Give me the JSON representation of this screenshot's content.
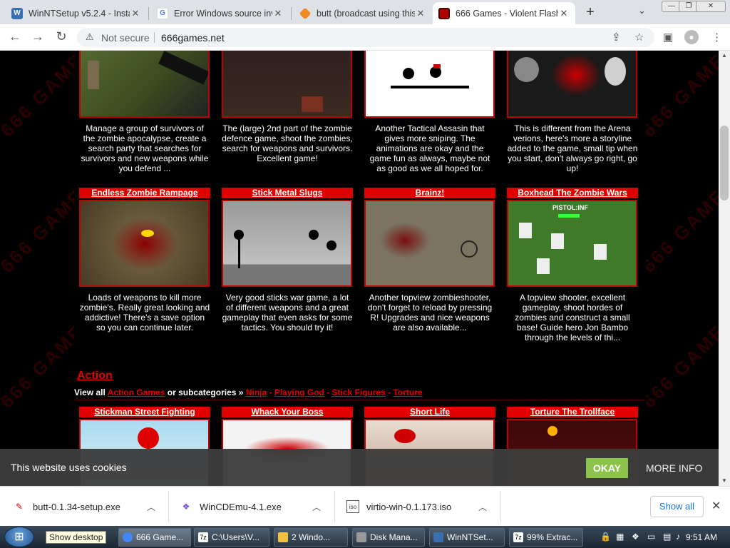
{
  "browser": {
    "tabs": [
      {
        "title": "WinNTSetup v5.2.4 - Insta",
        "icon": "winntsetup-favicon",
        "color": "#3a6fb0",
        "active": false
      },
      {
        "title": "Error Windows source inv",
        "icon": "google-favicon",
        "color": "#4285f4",
        "active": false
      },
      {
        "title": "butt (broadcast using this",
        "icon": "diamond-favicon",
        "color": "#f08a24",
        "active": false
      },
      {
        "title": "666 Games - Violent Flash",
        "icon": "666-favicon",
        "color": "#b00000",
        "active": true
      }
    ],
    "new_tab": "+",
    "not_secure": "Not secure",
    "url": "666games.net"
  },
  "games_row1": [
    {
      "desc": "Manage a group of survivors of the zombie apocalypse, create a search party that searches for survivors and new weapons while you defend ..."
    },
    {
      "desc": "The (large) 2nd part of the zombie defence game, shoot the zombies, search for weapons and survivors. Excellent game!"
    },
    {
      "desc": "Another Tactical Assasin that gives more sniping. The animations are okay and the game fun as always, maybe not as good as we all hoped for."
    },
    {
      "desc": "This is different from the Arena verions, here's more a storyline added to the game, small tip when you start, don't always go right, go up!"
    }
  ],
  "games_row2": [
    {
      "title": "Endless Zombie Rampage",
      "desc": "Loads of weapons to kill more zombie's. Really great looking and addictive! There's a save option so you can continue later."
    },
    {
      "title": "Stick Metal Slugs",
      "desc": "Very good sticks war game, a lot of different weapons and a great gameplay that even asks for some tactics. You should try it!"
    },
    {
      "title": "Brainz!",
      "desc": "Another topview zombieshooter, don't forget to reload by pressing R! Upgrades and nice weapons are also available..."
    },
    {
      "title": "Boxhead The Zombie Wars",
      "desc": "A topview shooter, excellent gameplay, shoot hordes of zombies and construct a small base! Guide hero Jon Bambo through the levels of thi...",
      "hud": "PISTOL:INF"
    }
  ],
  "section": {
    "title": "Action",
    "view_all_prefix": "View all",
    "view_all_link": "Action Games",
    "or_sub": "or subcategories »",
    "subcategories": [
      "Ninja",
      "Playing God",
      "Stick Figures",
      "Torture"
    ],
    "separator": "-"
  },
  "games_row3": [
    {
      "title": "Stickman Street Fighting"
    },
    {
      "title": "Whack Your Boss"
    },
    {
      "title": "Short Life"
    },
    {
      "title": "Torture The Trollface"
    }
  ],
  "cookie": {
    "text": "This website uses cookies",
    "ok": "OKAY",
    "more": "MORE INFO"
  },
  "downloads": [
    {
      "name": "butt-0.1.34-setup.exe",
      "icon": "installer-icon"
    },
    {
      "name": "WinCDEmu-4.1.exe",
      "icon": "wincdemu-icon"
    },
    {
      "name": "virtio-win-0.1.173.iso",
      "icon": "iso-icon"
    }
  ],
  "show_all": "Show all",
  "taskbar": {
    "show_desktop": "Show desktop",
    "items": [
      {
        "label": "666 Game...",
        "icon": "chrome-icon",
        "active": true
      },
      {
        "label": "C:\\Users\\V...",
        "icon": "7zip-icon",
        "active": false
      },
      {
        "label": "2 Windo...",
        "icon": "folder-icon",
        "active": false
      },
      {
        "label": "Disk Mana...",
        "icon": "disk-management-icon",
        "active": false
      },
      {
        "label": "WinNTSet...",
        "icon": "winntsetup-icon",
        "active": false
      },
      {
        "label": "99% Extrac...",
        "icon": "7zip-icon",
        "active": false
      }
    ],
    "clock": "9:51 AM"
  },
  "colors": {
    "accent_red": "#e00000",
    "okay_green": "#8bc34a",
    "link_blue": "#1a73e8"
  }
}
